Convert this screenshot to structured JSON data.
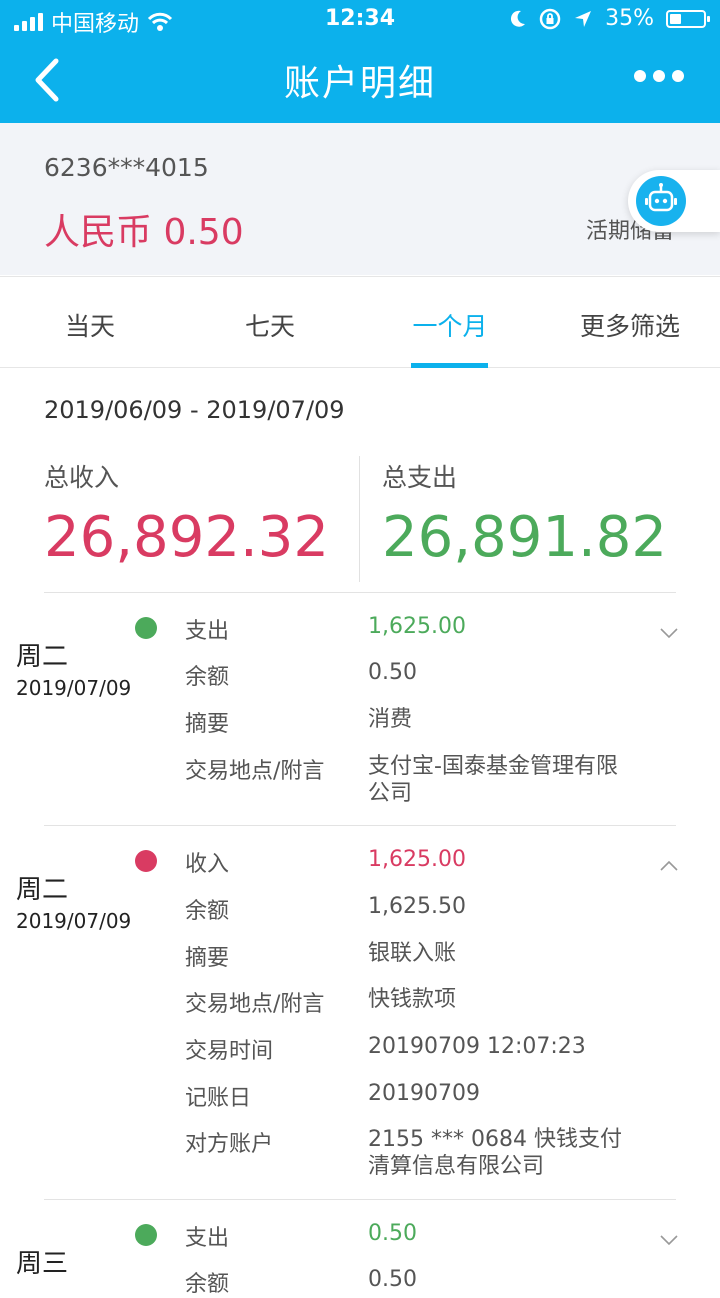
{
  "status_bar": {
    "carrier": "中国移动",
    "time": "12:34",
    "battery": "35%",
    "battery_level": 0.35
  },
  "nav": {
    "title": "账户明细"
  },
  "account": {
    "number": "6236***4015",
    "balance": "人民币 0.50",
    "type": "活期储蓄"
  },
  "tabs": [
    {
      "label": "当天"
    },
    {
      "label": "七天"
    },
    {
      "label": "一个月",
      "active": true
    },
    {
      "label": "更多筛选"
    }
  ],
  "summary": {
    "range": "2019/06/09 - 2019/07/09",
    "income_label": "总收入",
    "income_value": "26,892.32",
    "expense_label": "总支出",
    "expense_value": "26,891.82"
  },
  "records": [
    {
      "day": "周二",
      "date": "2019/07/09",
      "kind": "expense",
      "expanded": false,
      "rows": [
        {
          "label": "支出",
          "value": "1,625.00"
        },
        {
          "label": "余额",
          "value": "0.50"
        },
        {
          "label": "摘要",
          "value": "消费"
        },
        {
          "label": "交易地点/附言",
          "value": "支付宝-国泰基金管理有限",
          "value2": "公司"
        }
      ]
    },
    {
      "day": "周二",
      "date": "2019/07/09",
      "kind": "income",
      "expanded": true,
      "rows": [
        {
          "label": "收入",
          "value": "1,625.00"
        },
        {
          "label": "余额",
          "value": "1,625.50"
        },
        {
          "label": "摘要",
          "value": "银联入账"
        },
        {
          "label": "交易地点/附言",
          "value": "快钱款项"
        },
        {
          "label": "交易时间",
          "value": "20190709 12:07:23"
        },
        {
          "label": "记账日",
          "value": "20190709"
        },
        {
          "label": "对方账户",
          "value": "2155 *** 0684 快钱支付",
          "value2": "清算信息有限公司"
        }
      ]
    },
    {
      "day": "周三",
      "date": "",
      "kind": "expense",
      "expanded": false,
      "rows": [
        {
          "label": "支出",
          "value": "0.50"
        },
        {
          "label": "余额",
          "value": "0.50"
        }
      ]
    }
  ],
  "colors": {
    "brand": "#0cb1ec",
    "income": "#d93b62",
    "expense": "#4caa5b"
  }
}
